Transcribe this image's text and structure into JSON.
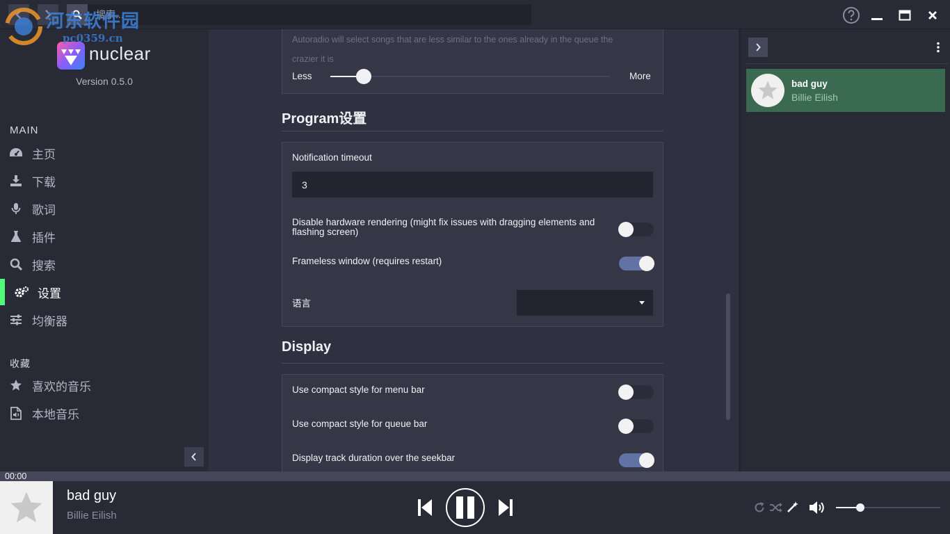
{
  "topbar": {
    "search_placeholder": "搜索..."
  },
  "watermark": {
    "title": "河东软件园",
    "url": "pc0359.cn"
  },
  "sidebar": {
    "brand": "nuclear",
    "version": "Version 0.5.0",
    "main_label": "MAIN",
    "items": [
      {
        "label": "主页",
        "icon": "dashboard-icon"
      },
      {
        "label": "下载",
        "icon": "download-icon"
      },
      {
        "label": "歌词",
        "icon": "microphone-icon"
      },
      {
        "label": "插件",
        "icon": "flask-icon"
      },
      {
        "label": "搜索",
        "icon": "search-icon"
      },
      {
        "label": "设置",
        "icon": "cogs-icon",
        "active": true
      },
      {
        "label": "均衡器",
        "icon": "sliders-icon"
      }
    ],
    "favorites_label": "收藏",
    "favorites": [
      {
        "label": "喜欢的音乐",
        "icon": "star-icon"
      },
      {
        "label": "本地音乐",
        "icon": "audio-file-icon"
      }
    ]
  },
  "settings": {
    "autoradio": {
      "description_line1": "Autoradio will select songs that are less similar to the ones already in the queue the",
      "description_line2": "crazier it is",
      "less_label": "Less",
      "more_label": "More",
      "craziness_fraction": 0.12
    },
    "program": {
      "title": "Program设置",
      "notification_label": "Notification timeout",
      "notification_value": "3",
      "hw_render_line1": "Disable hardware rendering (might fix issues with dragging elements and",
      "hw_render_line2": "flashing screen)",
      "hw_render_on": false,
      "frameless_label": "Frameless window (requires restart)",
      "frameless_on": true,
      "language_label": "语言",
      "language_value": ""
    },
    "display": {
      "title": "Display",
      "compact_menu_label": "Use compact style for menu bar",
      "compact_menu_on": false,
      "compact_queue_label": "Use compact style for queue bar",
      "compact_queue_on": false,
      "track_duration_label": "Display track duration over the seekbar",
      "track_duration_on": true
    }
  },
  "queue": {
    "items": [
      {
        "title": "bad guy",
        "artist": "Billie Eilish"
      }
    ]
  },
  "player": {
    "elapsed": "00:00",
    "title": "bad guy",
    "artist": "Billie Eilish",
    "volume_fraction": 0.23
  },
  "colors": {
    "accent_green": "#50fa7b",
    "queue_active": "#3a6b50",
    "toggle_on": "#6272a4"
  }
}
